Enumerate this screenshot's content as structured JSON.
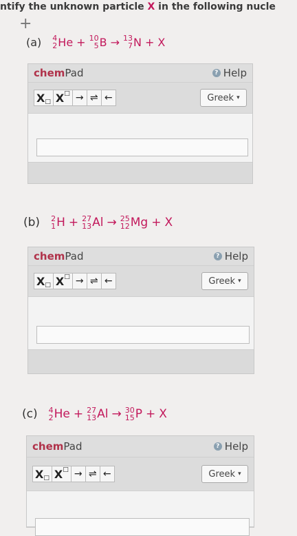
{
  "instruction": {
    "prefix": "ntify the unknown particle ",
    "x": "X",
    "suffix": " in the following nucle"
  },
  "problems": [
    {
      "label": "(a)",
      "reactants": [
        {
          "mass": "4",
          "atomic": "2",
          "symbol": "He"
        },
        {
          "mass": "10",
          "atomic": "5",
          "symbol": "B"
        }
      ],
      "products": [
        {
          "mass": "13",
          "atomic": "7",
          "symbol": "N"
        }
      ],
      "unknown": "X"
    },
    {
      "label": "(b)",
      "reactants": [
        {
          "mass": "2",
          "atomic": "1",
          "symbol": "H"
        },
        {
          "mass": "27",
          "atomic": "13",
          "symbol": "Al"
        }
      ],
      "products": [
        {
          "mass": "25",
          "atomic": "12",
          "symbol": "Mg"
        }
      ],
      "unknown": "X"
    },
    {
      "label": "(c)",
      "reactants": [
        {
          "mass": "4",
          "atomic": "2",
          "symbol": "He"
        },
        {
          "mass": "27",
          "atomic": "13",
          "symbol": "Al"
        }
      ],
      "products": [
        {
          "mass": "30",
          "atomic": "15",
          "symbol": "P"
        }
      ],
      "unknown": "X"
    }
  ],
  "chempad": {
    "title_chem": "chem",
    "title_pad": "Pad",
    "help_label": "Help",
    "help_icon_glyph": "?",
    "tools": {
      "subscript": "X",
      "subscript_mark": "□",
      "superscript": "X",
      "superscript_mark": "□",
      "arrow": "→",
      "equilibrium": "⇌",
      "left_arrow": "←"
    },
    "greek_label": "Greek",
    "greek_caret": "▾",
    "input_value": ""
  },
  "colors": {
    "equation_red": "#c2185b",
    "chem_brand": "#b0324a"
  }
}
